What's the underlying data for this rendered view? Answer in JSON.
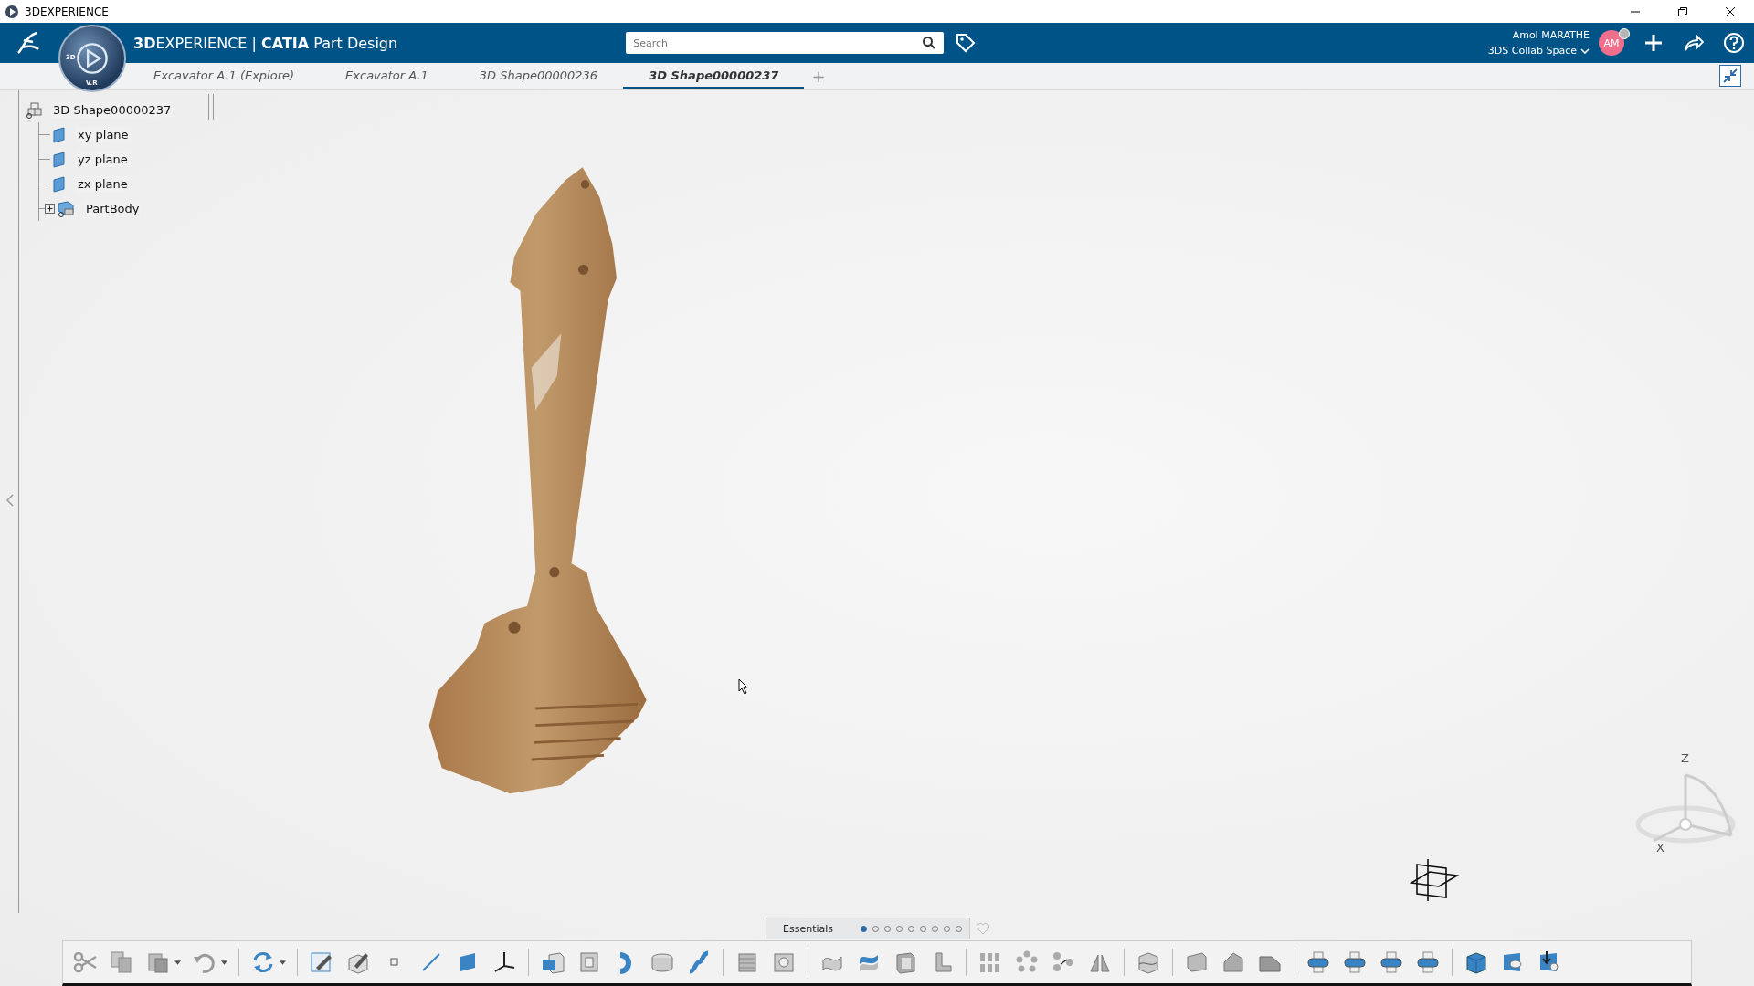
{
  "window": {
    "title": "3DEXPERIENCE"
  },
  "header": {
    "app_title": "**3D**EXPERIENCE | **CATIA** Part Design",
    "compass_labels": [
      "3D",
      "V.R"
    ],
    "search": {
      "placeholder": "Search"
    },
    "user": {
      "name": "Amol MARATHE",
      "space": "3DS Collab Space",
      "initials": "AM"
    }
  },
  "tabs": [
    {
      "label": "Excavator A.1 (Explore)",
      "selected": false
    },
    {
      "label": "Excavator A.1",
      "selected": false
    },
    {
      "label": "3D Shape00000236",
      "selected": false
    },
    {
      "label": "3D Shape00000237",
      "selected": true
    }
  ],
  "new_tab": "+",
  "tree": {
    "label": "3D Shape00000237",
    "children": [
      {
        "label": "xy plane",
        "kind": "plane"
      },
      {
        "label": "yz plane",
        "kind": "plane"
      },
      {
        "label": "zx plane",
        "kind": "plane"
      },
      {
        "label": "PartBody",
        "kind": "body",
        "expanded": false
      }
    ]
  },
  "compass_axes": [
    "Z",
    "X"
  ],
  "section_bar": {
    "label": "Essentials",
    "pages": [
      {
        "selected": true
      },
      {
        "selected": false
      },
      {
        "selected": false
      },
      {
        "selected": false
      },
      {
        "selected": false
      },
      {
        "selected": false
      },
      {
        "selected": false
      },
      {
        "selected": false
      },
      {
        "selected": false
      }
    ]
  }
}
